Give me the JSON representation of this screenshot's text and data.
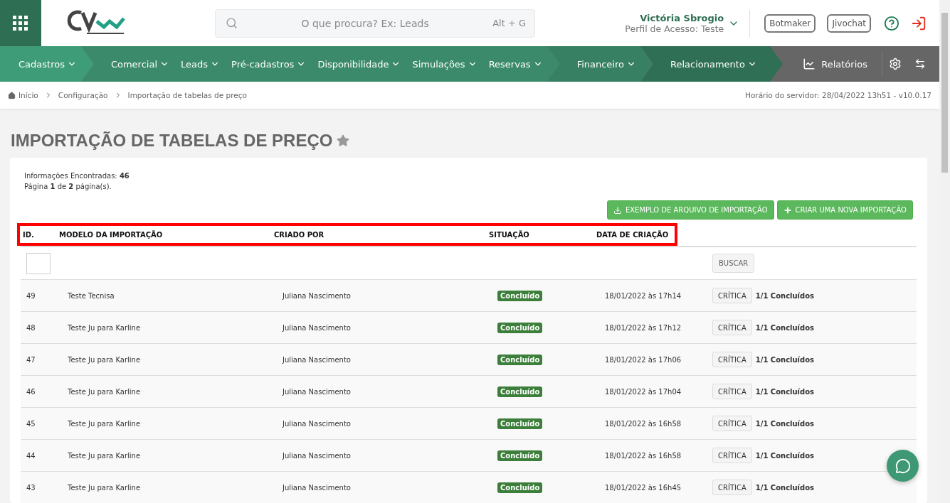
{
  "header": {
    "search": {
      "placeholder": "O que procura? Ex: Leads",
      "shortcut": "Alt + G"
    },
    "user": {
      "name": "Victória Sbrogio",
      "profile": "Perfil de Acesso: Teste"
    },
    "buttons": [
      "Botmaker",
      "Jivochat"
    ]
  },
  "nav": {
    "groups": [
      {
        "items": [
          "Cadastros"
        ]
      },
      {
        "items": [
          "Comercial",
          "Leads",
          "Pré-cadastros",
          "Disponibilidade",
          "Simulações",
          "Reservas"
        ]
      },
      {
        "items": [
          "Financeiro"
        ]
      },
      {
        "items": [
          "Relacionamento"
        ]
      }
    ],
    "reports": "Relatórios"
  },
  "breadcrumb": [
    "Início",
    "Configuração",
    "Importação de tabelas de preço"
  ],
  "server_time": "Horário do servidor: 28/04/2022 13h51 - v10.0.17",
  "page_title": "IMPORTAÇÃO DE TABELAS DE PREÇO",
  "summary": [
    "Informações Encontradas: **46**",
    "Página **1** de **2** página(s)."
  ],
  "actions": [
    "EXEMPLO DE ARQUIVO DE IMPORTAÇÃO",
    "CRIAR UMA NOVA IMPORTAÇÃO"
  ],
  "table": {
    "columns": [
      "ID.",
      "MODELO DA IMPORTAÇÃO",
      "CRIADO POR",
      "SITUAÇÃO",
      "DATA DE CRIAÇÃO"
    ],
    "search_button": "BUSCAR",
    "rows": [
      {
        "id": "49",
        "model": "Teste Tecnisa",
        "created_by": "Juliana Nascimento",
        "status": "Concluído",
        "date": "18/01/2022 às 17h14",
        "action": "CRÍTICA",
        "progress": "1/1 Concluídos"
      },
      {
        "id": "48",
        "model": "Teste Ju para Karline",
        "created_by": "Juliana Nascimento",
        "status": "Concluído",
        "date": "18/01/2022 às 17h12",
        "action": "CRÍTICA",
        "progress": "1/1 Concluídos"
      },
      {
        "id": "47",
        "model": "Teste Ju para Karline",
        "created_by": "Juliana Nascimento",
        "status": "Concluído",
        "date": "18/01/2022 às 17h06",
        "action": "CRÍTICA",
        "progress": "1/1 Concluídos"
      },
      {
        "id": "46",
        "model": "Teste Ju para Karline",
        "created_by": "Juliana Nascimento",
        "status": "Concluído",
        "date": "18/01/2022 às 17h04",
        "action": "CRÍTICA",
        "progress": "1/1 Concluídos"
      },
      {
        "id": "45",
        "model": "Teste Ju para Karline",
        "created_by": "Juliana Nascimento",
        "status": "Concluído",
        "date": "18/01/2022 às 16h58",
        "action": "CRÍTICA",
        "progress": "1/1 Concluídos"
      },
      {
        "id": "44",
        "model": "Teste Ju para Karline",
        "created_by": "Juliana Nascimento",
        "status": "Concluído",
        "date": "18/01/2022 às 16h58",
        "action": "CRÍTICA",
        "progress": "1/1 Concluídos"
      },
      {
        "id": "43",
        "model": "Teste Ju para Karline",
        "created_by": "Juliana Nascimento",
        "status": "Concluído",
        "date": "18/01/2022 às 16h45",
        "action": "CRÍTICA",
        "progress": "1/1 Concluídos"
      }
    ]
  }
}
